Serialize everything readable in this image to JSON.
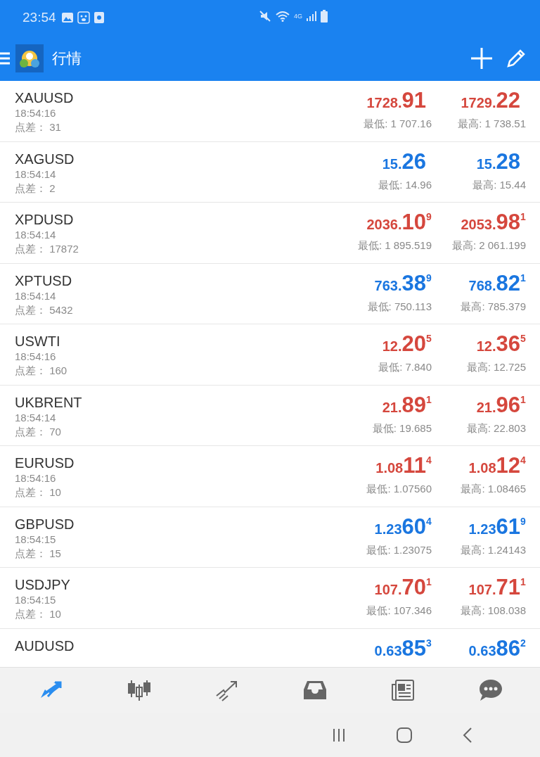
{
  "status_bar": {
    "time": "23:54",
    "network": "4G"
  },
  "header": {
    "title": "行情"
  },
  "quotes": [
    {
      "symbol": "XAUUSD",
      "time": "18:54:16",
      "spread": "点差： 31",
      "color": "#d5473d",
      "bid": {
        "pre": "1728.",
        "big": "91"
      },
      "ask": {
        "pre": "1729.",
        "big": "22"
      },
      "low": "最低: 1 707.16",
      "high": "最高: 1 738.51"
    },
    {
      "symbol": "XAGUSD",
      "time": "18:54:14",
      "spread": "点差： 2",
      "color": "#1a76e0",
      "bid": {
        "pre": "15.",
        "big": "26"
      },
      "ask": {
        "pre": "15.",
        "big": "28"
      },
      "low": "最低: 14.96",
      "high": "最高: 15.44"
    },
    {
      "symbol": "XPDUSD",
      "time": "18:54:14",
      "spread": "点差： 17872",
      "color": "#d5473d",
      "bid": {
        "pre": "2036.",
        "big": "10",
        "sup": "9"
      },
      "ask": {
        "pre": "2053.",
        "big": "98",
        "sup": "1"
      },
      "low": "最低: 1 895.519",
      "high": "最高: 2 061.199"
    },
    {
      "symbol": "XPTUSD",
      "time": "18:54:14",
      "spread": "点差： 5432",
      "color": "#1a76e0",
      "bid": {
        "pre": "763.",
        "big": "38",
        "sup": "9"
      },
      "ask": {
        "pre": "768.",
        "big": "82",
        "sup": "1"
      },
      "low": "最低: 750.113",
      "high": "最高: 785.379"
    },
    {
      "symbol": "USWTI",
      "time": "18:54:16",
      "spread": "点差： 160",
      "color": "#d5473d",
      "bid": {
        "pre": "12.",
        "big": "20",
        "sup": "5"
      },
      "ask": {
        "pre": "12.",
        "big": "36",
        "sup": "5"
      },
      "low": "最低: 7.840",
      "high": "最高: 12.725"
    },
    {
      "symbol": "UKBRENT",
      "time": "18:54:14",
      "spread": "点差： 70",
      "color": "#d5473d",
      "bid": {
        "pre": "21.",
        "big": "89",
        "sup": "1"
      },
      "ask": {
        "pre": "21.",
        "big": "96",
        "sup": "1"
      },
      "low": "最低: 19.685",
      "high": "最高: 22.803"
    },
    {
      "symbol": "EURUSD",
      "time": "18:54:16",
      "spread": "点差： 10",
      "color": "#d5473d",
      "bid": {
        "pre": "1.08",
        "big": "11",
        "sup": "4"
      },
      "ask": {
        "pre": "1.08",
        "big": "12",
        "sup": "4"
      },
      "low": "最低: 1.07560",
      "high": "最高: 1.08465"
    },
    {
      "symbol": "GBPUSD",
      "time": "18:54:15",
      "spread": "点差： 15",
      "color": "#1a76e0",
      "bid": {
        "pre": "1.23",
        "big": "60",
        "sup": "4"
      },
      "ask": {
        "pre": "1.23",
        "big": "61",
        "sup": "9"
      },
      "low": "最低: 1.23075",
      "high": "最高: 1.24143"
    },
    {
      "symbol": "USDJPY",
      "time": "18:54:15",
      "spread": "点差： 10",
      "color": "#d5473d",
      "bid": {
        "pre": "107.",
        "big": "70",
        "sup": "1"
      },
      "ask": {
        "pre": "107.",
        "big": "71",
        "sup": "1"
      },
      "low": "最低: 107.346",
      "high": "最高: 108.038"
    },
    {
      "symbol": "AUDUSD",
      "color": "#1a76e0",
      "bid": {
        "pre": "0.63",
        "big": "85",
        "sup": "3"
      },
      "ask": {
        "pre": "0.63",
        "big": "86",
        "sup": "2"
      }
    }
  ],
  "bottom_nav": [
    {
      "kind": "quotes",
      "selected": true
    },
    {
      "kind": "chart",
      "selected": false
    },
    {
      "kind": "trade",
      "selected": false
    },
    {
      "kind": "history",
      "selected": false
    },
    {
      "kind": "news",
      "selected": false
    },
    {
      "kind": "chat",
      "selected": false
    }
  ]
}
